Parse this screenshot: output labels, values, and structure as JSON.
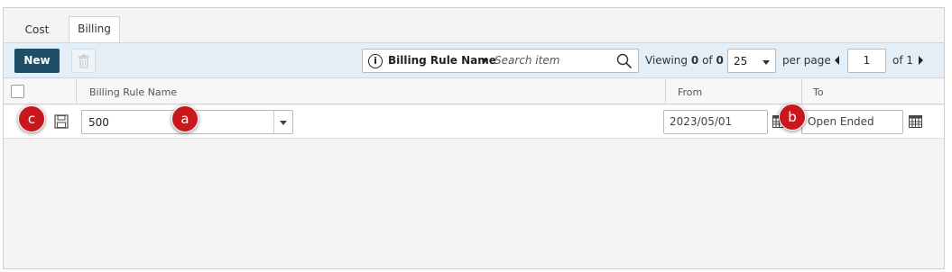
{
  "tabs": [
    {
      "label": "Cost",
      "active": false
    },
    {
      "label": "Billing",
      "active": true
    }
  ],
  "toolbar": {
    "new_label": "New",
    "delete_icon": "trash-icon",
    "search": {
      "field_label": "Billing Rule Name",
      "placeholder": "Search item"
    },
    "viewing": {
      "prefix": "Viewing",
      "from": "0",
      "of_word": "of",
      "total": "0"
    },
    "per_page": {
      "value": "25",
      "label": "per page"
    },
    "pagination": {
      "page": "1",
      "of_label": "of 1"
    }
  },
  "columns": {
    "billing_rule_name": "Billing Rule Name",
    "from": "From",
    "to": "To"
  },
  "row": {
    "billing_rule_value": "500",
    "from_value": "2023/05/01",
    "to_value": "Open Ended"
  },
  "markers": {
    "a": "a",
    "b": "b",
    "c": "c",
    "color": "#c8171d"
  },
  "colors": {
    "new_button": "#1f4f66",
    "toolbar_bg": "#e4eef7"
  }
}
